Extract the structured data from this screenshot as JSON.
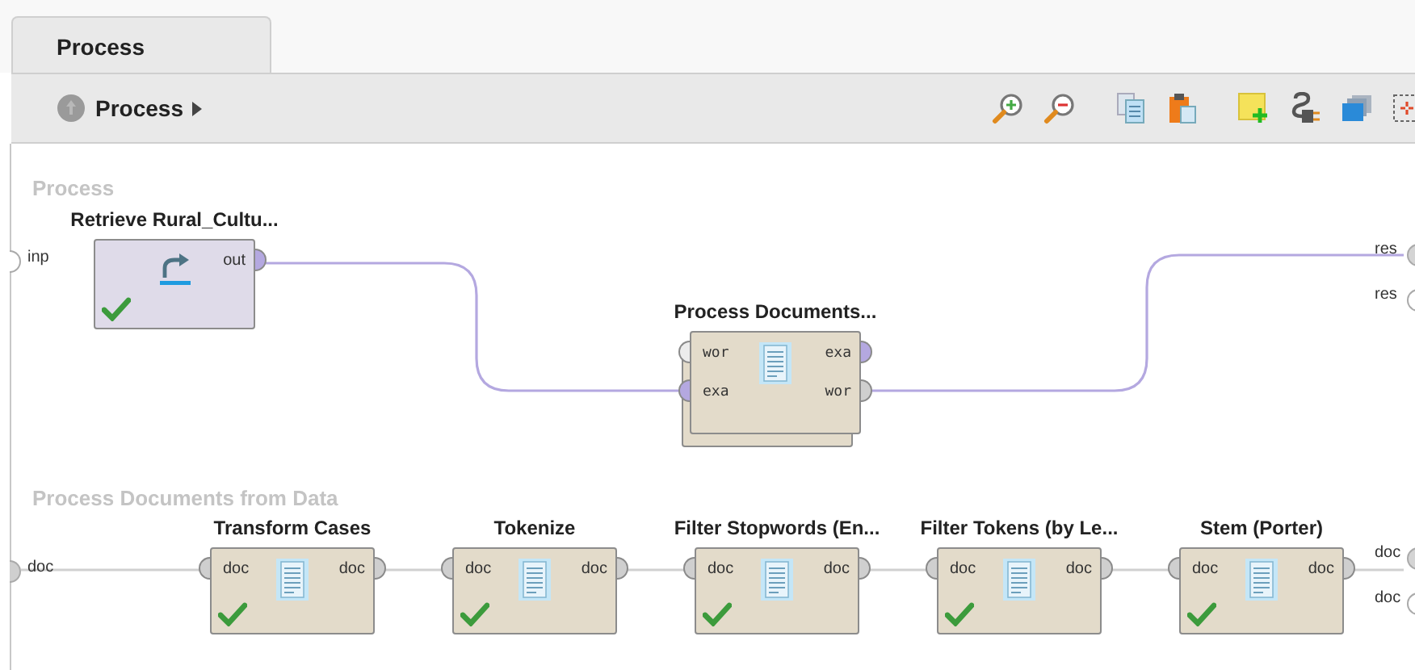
{
  "tabs": [
    {
      "label": "Process",
      "selected": true
    }
  ],
  "breadcrumb": {
    "label": "Process"
  },
  "sections": [
    {
      "title": "Process",
      "input_ports": [
        {
          "label": "inp",
          "color": "#ffffff"
        }
      ],
      "output_ports": [
        {
          "label": "res",
          "color": "#d4d4d4"
        },
        {
          "label": "res",
          "color": "#ffffff"
        }
      ],
      "operators": [
        {
          "name": "Retrieve Rural_Cultu...",
          "kind": "retrieve",
          "ok": true,
          "stacked": false,
          "outputs": [
            {
              "label": "out",
              "color": "#b4a8e0"
            }
          ]
        },
        {
          "name": "Process Documents...",
          "kind": "document",
          "ok": false,
          "stacked": true,
          "inputs": [
            {
              "label": "wor",
              "color": "#ececec"
            },
            {
              "label": "exa",
              "color": "#b4a8e0"
            }
          ],
          "outputs": [
            {
              "label": "exa",
              "color": "#b4a8e0"
            },
            {
              "label": "wor",
              "color": "#cfcfcf"
            }
          ]
        }
      ]
    },
    {
      "title": "Process Documents from Data",
      "input_ports": [
        {
          "label": "doc",
          "color": "#cfcfcf"
        }
      ],
      "output_ports": [
        {
          "label": "doc",
          "color": "#d4d4d4"
        },
        {
          "label": "doc",
          "color": "#ffffff"
        }
      ],
      "operators": [
        {
          "name": "Transform Cases",
          "kind": "document",
          "ok": true,
          "stacked": false,
          "inputs": [
            {
              "label": "doc",
              "color": "#cfcfcf"
            }
          ],
          "outputs": [
            {
              "label": "doc",
              "color": "#cfcfcf"
            }
          ]
        },
        {
          "name": "Tokenize",
          "kind": "document",
          "ok": true,
          "stacked": false,
          "inputs": [
            {
              "label": "doc",
              "color": "#cfcfcf"
            }
          ],
          "outputs": [
            {
              "label": "doc",
              "color": "#cfcfcf"
            }
          ]
        },
        {
          "name": "Filter Stopwords (En...",
          "kind": "document",
          "ok": true,
          "stacked": false,
          "inputs": [
            {
              "label": "doc",
              "color": "#cfcfcf"
            }
          ],
          "outputs": [
            {
              "label": "doc",
              "color": "#cfcfcf"
            }
          ]
        },
        {
          "name": "Filter Tokens (by Le...",
          "kind": "document",
          "ok": true,
          "stacked": false,
          "inputs": [
            {
              "label": "doc",
              "color": "#cfcfcf"
            }
          ],
          "outputs": [
            {
              "label": "doc",
              "color": "#cfcfcf"
            }
          ]
        },
        {
          "name": "Stem (Porter)",
          "kind": "document",
          "ok": true,
          "stacked": false,
          "inputs": [
            {
              "label": "doc",
              "color": "#cfcfcf"
            }
          ],
          "outputs": [
            {
              "label": "doc",
              "color": "#cfcfcf"
            }
          ]
        }
      ]
    }
  ]
}
